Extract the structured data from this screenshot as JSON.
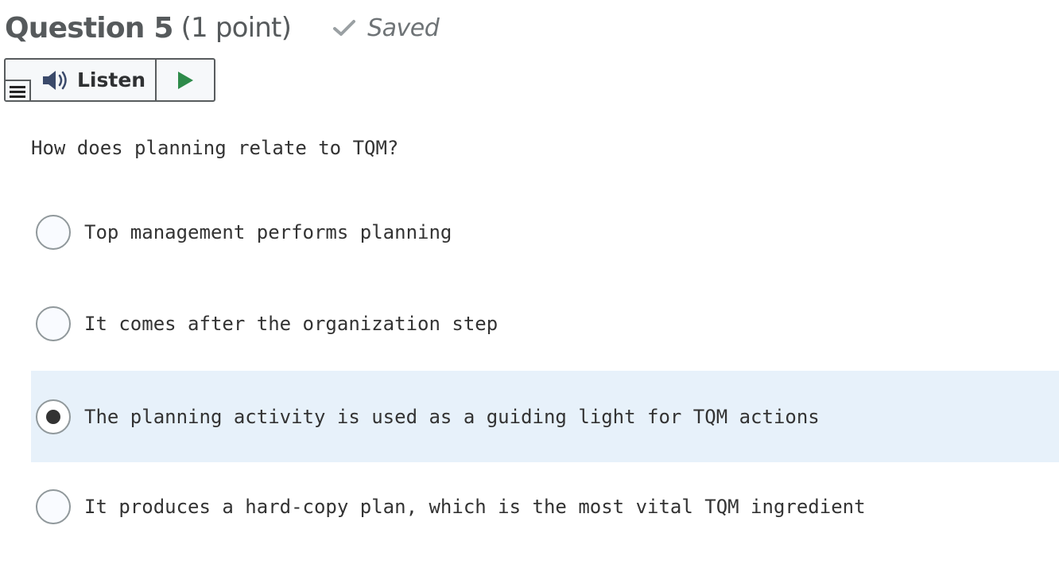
{
  "header": {
    "title": "Question 5",
    "points": "(1 point)",
    "status": "Saved",
    "status_icon": "checkmark-icon"
  },
  "listen": {
    "label": "Listen",
    "menu_icon": "menu-icon",
    "speaker_icon": "speaker-icon",
    "play_icon": "play-icon",
    "colors": {
      "play": "#2e8b4a",
      "speaker": "#3b4a6b"
    }
  },
  "question": {
    "text": "How does planning relate to TQM?"
  },
  "options": [
    {
      "label": "Top management performs planning",
      "selected": false
    },
    {
      "label": "It comes after the organization step",
      "selected": false
    },
    {
      "label": "The planning activity is used as a guiding light for TQM actions",
      "selected": true
    },
    {
      "label": "It produces a hard-copy plan, which is the most vital TQM ingredient",
      "selected": false
    }
  ],
  "colors": {
    "selected_row": "#e7f1fa",
    "text": "#333333",
    "saved_check": "#9aa0a3"
  }
}
